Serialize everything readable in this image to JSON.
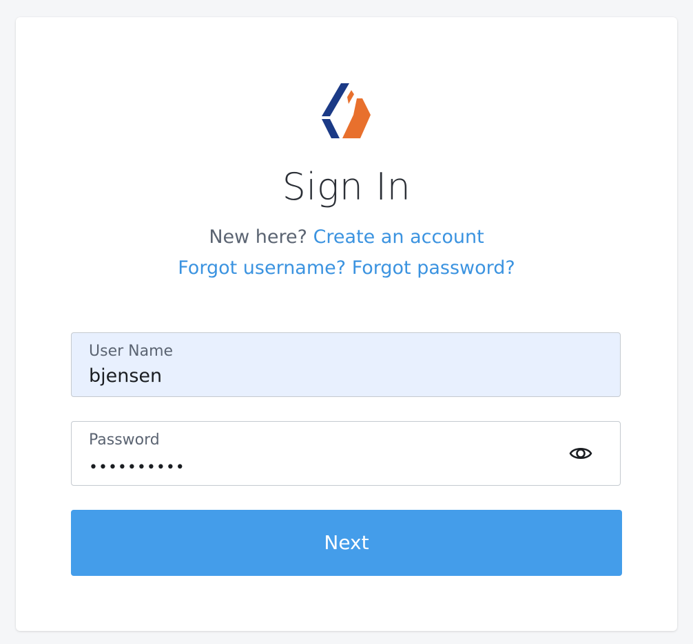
{
  "heading": {
    "title": "Sign In"
  },
  "links": {
    "new_here_text": "New here?",
    "create_account": "Create an account",
    "forgot_username": "Forgot username?",
    "forgot_password": "Forgot password?"
  },
  "username": {
    "label": "User Name",
    "value": "bjensen"
  },
  "password": {
    "label": "Password",
    "masked_value": "••••••••••"
  },
  "buttons": {
    "next": "Next"
  },
  "icons": {
    "logo": "brand-logo-icon",
    "show_password": "eye-icon"
  },
  "colors": {
    "accent": "#449dea",
    "link": "#3b93e0",
    "logo_blue": "#1b3a86",
    "logo_orange": "#e8702d",
    "autofill_bg": "#e8f0fe"
  }
}
